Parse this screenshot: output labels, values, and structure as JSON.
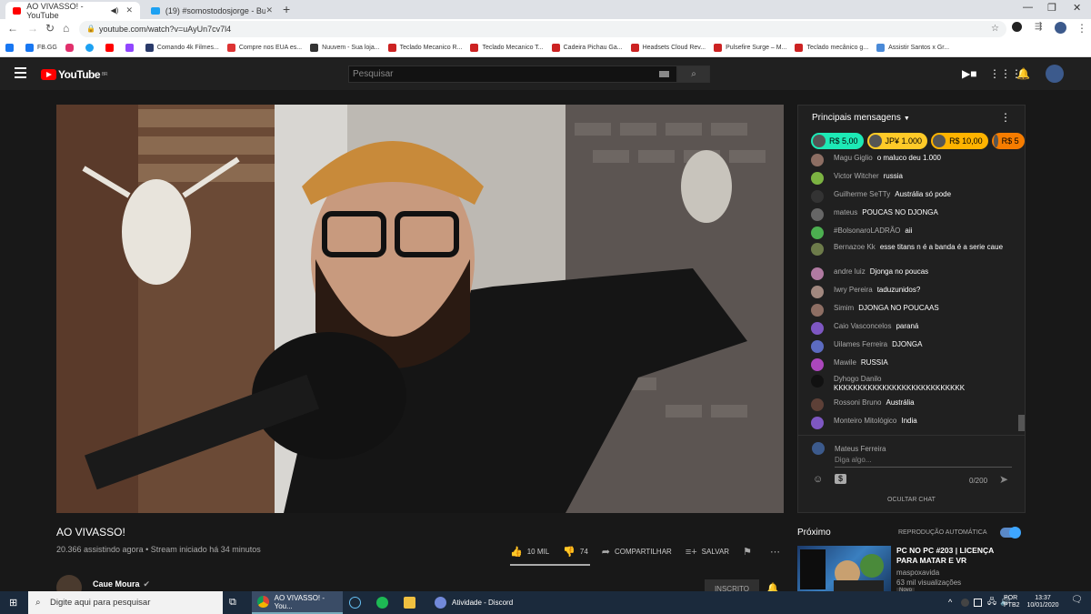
{
  "browser": {
    "tabs": [
      {
        "title": "AO VIVASSO! - YouTube",
        "active": true,
        "favicon_color": "#ff0000"
      },
      {
        "title": "(19) #somostodosjorge - Buscar",
        "active": false,
        "favicon_color": "#1da1f2"
      }
    ],
    "new_tab": "+",
    "url": "youtube.com/watch?v=uAyUn7cv7l4",
    "bookmarks": [
      {
        "label": "",
        "color": "#1877f2"
      },
      {
        "label": "FB.GG",
        "color": "#1877f2"
      },
      {
        "label": "",
        "color": "#e1306c"
      },
      {
        "label": "",
        "color": "#1da1f2"
      },
      {
        "label": "",
        "color": "#ff0000"
      },
      {
        "label": "",
        "color": "#9146ff"
      },
      {
        "label": "Comando 4k Filmes...",
        "color": "#2a3a6a"
      },
      {
        "label": "Compre nos EUA es...",
        "color": "#d33"
      },
      {
        "label": "Nuuvem - Sua loja...",
        "color": "#333"
      },
      {
        "label": "Teclado Mecanico R...",
        "color": "#c22"
      },
      {
        "label": "Teclado Mecanico T...",
        "color": "#c22"
      },
      {
        "label": "Cadeira Pichau Ga...",
        "color": "#c22"
      },
      {
        "label": "Headsets Cloud Rev...",
        "color": "#c22"
      },
      {
        "label": "Pulsefire Surge – M...",
        "color": "#c22"
      },
      {
        "label": "Teclado mecânico g...",
        "color": "#c22"
      },
      {
        "label": "Assistir Santos x Gr...",
        "color": "#4a8ad8"
      }
    ]
  },
  "youtube": {
    "logo_text": "YouTube",
    "logo_region": "BR",
    "search_placeholder": "Pesquisar",
    "video": {
      "title": "AO VIVASSO!",
      "meta": "20.366 assistindo agora • Stream iniciado há 34 minutos",
      "likes": "10 MIL",
      "dislikes": "74",
      "share": "COMPARTILHAR",
      "save": "SALVAR"
    },
    "channel": {
      "name": "Caue Moura",
      "subscribe": "INSCRITO"
    },
    "chat": {
      "header": "Principais mensagens",
      "tickers": [
        {
          "amount": "R$ 5,00",
          "color": "#1de9b6"
        },
        {
          "amount": "JP¥ 1.000",
          "color": "#ffca28"
        },
        {
          "amount": "R$ 10,00",
          "color": "#ffb300"
        },
        {
          "amount": "R$ 5",
          "color": "#f57c00"
        }
      ],
      "messages": [
        {
          "author": "Magu Giglio",
          "text": "o maluco deu 1.000",
          "color": "#8d6e63"
        },
        {
          "author": "Victor Witcher",
          "text": "russia",
          "color": "#7cb342"
        },
        {
          "author": "Guilherme SeTTy",
          "text": "Austrália só pode",
          "color": "#333333"
        },
        {
          "author": "mateus",
          "text": "POUCAS NO DJONGA",
          "color": "#666666"
        },
        {
          "author": "#BolsonaroLADRÃO",
          "text": "aii",
          "color": "#4caf50"
        },
        {
          "author": "Bernazoe Kk",
          "text": "esse titans n é a banda é a serie caue",
          "color": "#6d7b4a"
        },
        {
          "author": "andre luiz",
          "text": "Djonga no poucas",
          "color": "#b07aa1"
        },
        {
          "author": "Iwry Pereira",
          "text": "taduzunidos?",
          "color": "#a1887f"
        },
        {
          "author": "Simim",
          "text": "DJONGA NO POUCAAS",
          "color": "#8d6e63"
        },
        {
          "author": "Caio Vasconcelos",
          "text": "paraná",
          "color": "#7e57c2"
        },
        {
          "author": "Uilames Ferreira",
          "text": "DJONGA",
          "color": "#5c6bc0"
        },
        {
          "author": "Mawile",
          "text": "RUSSIA",
          "color": "#ab47bc"
        },
        {
          "author": "Dyhogo Danilo",
          "text": "KKKKKKKKKKKKKKKKKKKKKKKKKKK",
          "color": "#111111"
        },
        {
          "author": "Rossoni Bruno",
          "text": "Austrália",
          "color": "#5d4037"
        },
        {
          "author": "Monteiro Mitológico",
          "text": "India",
          "color": "#7e57c2"
        }
      ],
      "user_name": "Mateus Ferreira",
      "input_placeholder": "Diga algo...",
      "char_count": "0/200",
      "hide_chat": "OCULTAR CHAT"
    },
    "up_next": {
      "label": "Próximo",
      "autoplay": "REPRODUÇÃO AUTOMÁTICA",
      "title": "PC NO PC #203 | LICENÇA PARA MATAR E VR",
      "channel": "maspoxavida",
      "views": "63 mil visualizações",
      "badge": "Novo"
    }
  },
  "taskbar": {
    "search_placeholder": "Digite aqui para pesquisar",
    "chrome_item": "AO VIVASSO! - You...",
    "discord_item": "Atividade - Discord",
    "lang": "POR",
    "lang2": "PTB2",
    "time": "13:37",
    "date": "10/01/2020"
  }
}
